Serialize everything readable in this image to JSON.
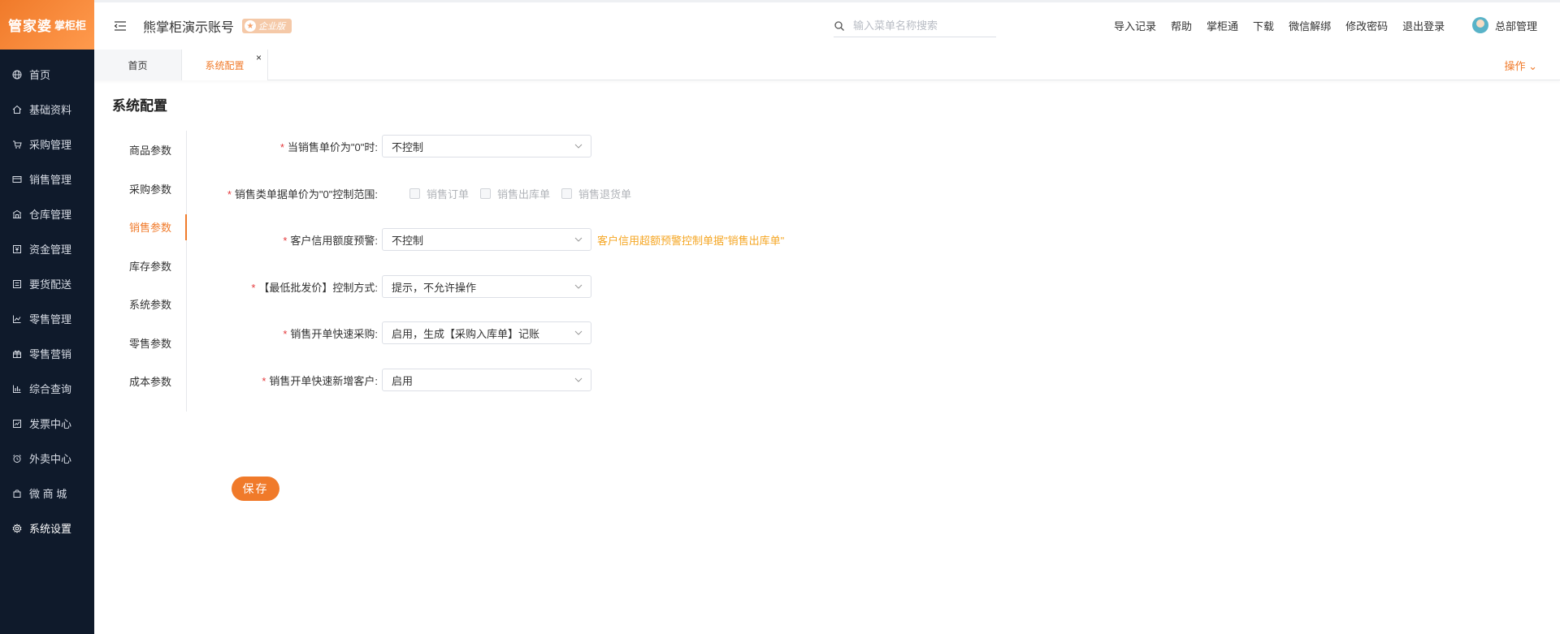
{
  "logo": {
    "brand": "管家婆",
    "sub": "掌柜柜"
  },
  "sidebar": {
    "items": [
      {
        "label": "首页",
        "icon": "globe-icon"
      },
      {
        "label": "基础资料",
        "icon": "home-icon"
      },
      {
        "label": "采购管理",
        "icon": "cart-icon"
      },
      {
        "label": "销售管理",
        "icon": "sales-card-icon"
      },
      {
        "label": "仓库管理",
        "icon": "warehouse-icon"
      },
      {
        "label": "资金管理",
        "icon": "money-icon"
      },
      {
        "label": "要货配送",
        "icon": "list-icon"
      },
      {
        "label": "零售管理",
        "icon": "chart-icon"
      },
      {
        "label": "零售营销",
        "icon": "gift-icon"
      },
      {
        "label": "综合查询",
        "icon": "bar-chart-icon"
      },
      {
        "label": "发票中心",
        "icon": "invoice-icon"
      },
      {
        "label": "外卖中心",
        "icon": "alarm-icon"
      },
      {
        "label": "微 商 城",
        "icon": "bag-icon"
      },
      {
        "label": "系统设置",
        "icon": "gear-icon"
      }
    ],
    "active_index": 13
  },
  "header": {
    "account_title": "熊掌柜演示账号",
    "badge": "企业版",
    "search_placeholder": "输入菜单名称搜索",
    "links": [
      "导入记录",
      "帮助",
      "掌柜通",
      "下载",
      "微信解绑",
      "修改密码",
      "退出登录"
    ],
    "user": "总部管理"
  },
  "tabs": {
    "home": "首页",
    "current": "系统配置",
    "close": "×",
    "ops": "操作 ⌄"
  },
  "page": {
    "title": "系统配置",
    "subnav": [
      "商品参数",
      "采购参数",
      "销售参数",
      "库存参数",
      "系统参数",
      "零售参数",
      "成本参数"
    ],
    "subnav_active": 2
  },
  "form": {
    "required_mark": "*",
    "rows": [
      {
        "label": "当销售单价为\"0\"时:",
        "value": "不控制"
      },
      {
        "label": "销售类单据单价为\"0\"控制范围:",
        "checks": [
          "销售订单",
          "销售出库单",
          "销售退货单"
        ]
      },
      {
        "label": "客户信用额度预警:",
        "value": "不控制",
        "hint": "客户信用超额预警控制单据\"销售出库单\""
      },
      {
        "label": "【最低批发价】控制方式:",
        "value": "提示，不允许操作"
      },
      {
        "label": "销售开单快速采购:",
        "value": "启用，生成【采购入库单】记账"
      },
      {
        "label": "销售开单快速新增客户:",
        "value": "启用"
      }
    ],
    "save_label": "保存"
  },
  "colors": {
    "accent": "#f07a2a",
    "sidebar_bg": "#0f1a2b",
    "hint": "#f5a623",
    "required": "#e4393c"
  }
}
